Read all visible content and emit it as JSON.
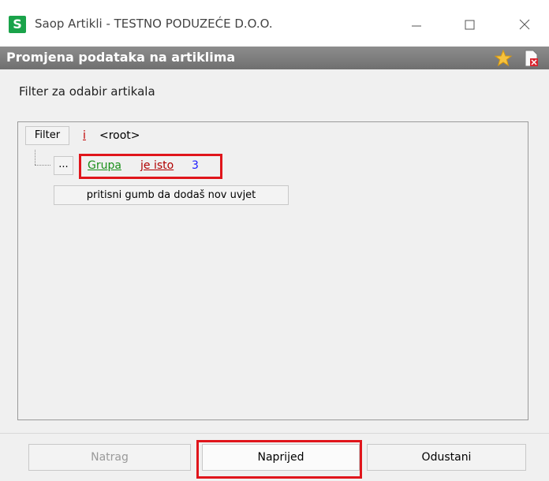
{
  "window": {
    "app_icon_letter": "S",
    "title": "Saop Artikli - TESTNO PODUZEĆE D.O.O.",
    "minimize_icon": "minimize-icon",
    "maximize_icon": "maximize-icon",
    "close_icon": "close-icon"
  },
  "header": {
    "title": "Promjena podataka na artiklima",
    "favorite_icon": "star-icon",
    "document_icon": "document-close-icon"
  },
  "filter": {
    "section_label": "Filter za odabir artikala",
    "filter_button_label": "Filter",
    "root_operator": "i",
    "root_label": "<root>",
    "condition": {
      "options_button_label": "...",
      "field": "Grupa",
      "operator": "je isto",
      "value": "3"
    },
    "add_condition_label": "pritisni gumb da dodaš nov uvjet"
  },
  "footer": {
    "back_label": "Natrag",
    "next_label": "Naprijed",
    "cancel_label": "Odustani"
  },
  "colors": {
    "highlight": "#e0151b",
    "field_green": "#1a8f1a",
    "operator_red": "#b00000",
    "value_blue": "#1a1aff"
  }
}
